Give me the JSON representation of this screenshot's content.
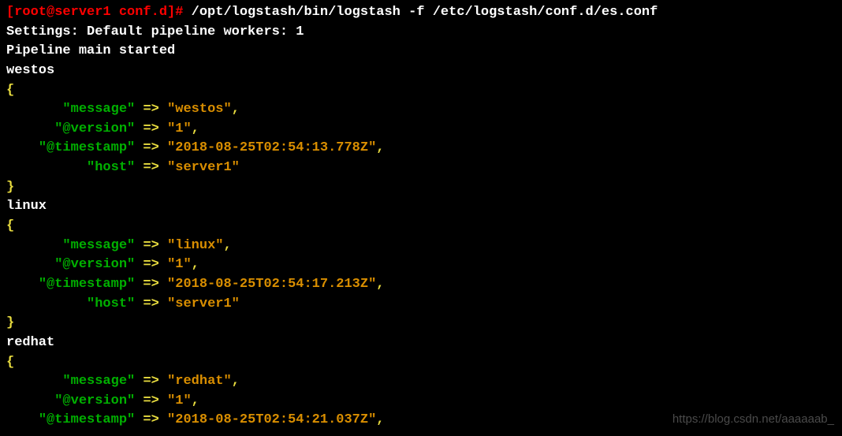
{
  "prompt": {
    "user_host": "[root@server1 conf.d]# ",
    "command": "/opt/logstash/bin/logstash -f /etc/logstash/conf.d/es.conf"
  },
  "output": {
    "settings_line": "Settings: Default pipeline workers: 1",
    "pipeline_line": "Pipeline main started"
  },
  "entries": [
    {
      "input": "westos",
      "message_key": "\"message\"",
      "message_val": "\"westos\"",
      "version_key": "\"@version\"",
      "version_val": "\"1\"",
      "timestamp_key": "\"@timestamp\"",
      "timestamp_val": "\"2018-08-25T02:54:13.778Z\"",
      "host_key": "\"host\"",
      "host_val": "\"server1\""
    },
    {
      "input": "linux",
      "message_key": "\"message\"",
      "message_val": "\"linux\"",
      "version_key": "\"@version\"",
      "version_val": "\"1\"",
      "timestamp_key": "\"@timestamp\"",
      "timestamp_val": "\"2018-08-25T02:54:17.213Z\"",
      "host_key": "\"host\"",
      "host_val": "\"server1\""
    },
    {
      "input": "redhat",
      "message_key": "\"message\"",
      "message_val": "\"redhat\"",
      "version_key": "\"@version\"",
      "version_val": "\"1\"",
      "timestamp_key": "\"@timestamp\"",
      "timestamp_val": "\"2018-08-25T02:54:21.037Z\""
    }
  ],
  "arrow": " => ",
  "comma": ",",
  "brace_open": "{",
  "brace_close": "}",
  "watermark": "https://blog.csdn.net/aaaaaab_"
}
